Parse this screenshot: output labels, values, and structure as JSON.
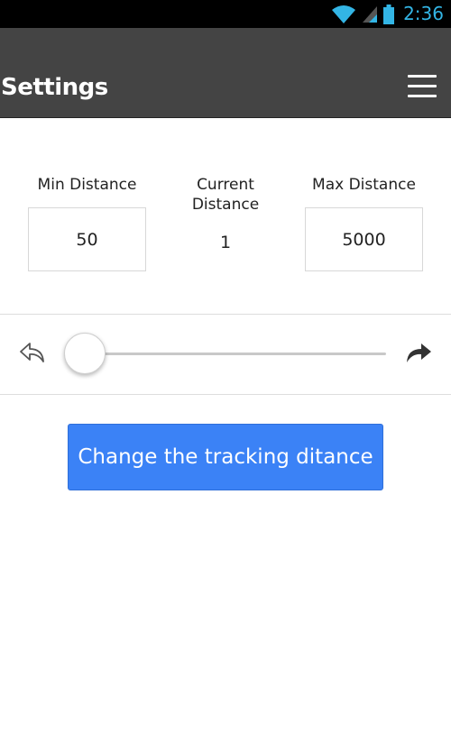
{
  "status_bar": {
    "time": "2:36",
    "icons": [
      "wifi-icon",
      "cell-signal-icon",
      "battery-icon"
    ]
  },
  "app_bar": {
    "title": "Settings",
    "menu_icon": "hamburger-menu-icon"
  },
  "distance": {
    "min_label": "Min Distance",
    "min_value": "50",
    "current_label": "Current Distance",
    "current_value": "1",
    "max_label": "Max Distance",
    "max_value": "5000"
  },
  "slider": {
    "value": 1,
    "min": 50,
    "max": 5000,
    "left_icon": "undo-arrow-icon",
    "right_icon": "redo-arrow-icon"
  },
  "action": {
    "button_label": "Change the tracking ditance"
  },
  "colors": {
    "status_bar_bg": "#000000",
    "status_accent": "#33b5e5",
    "app_bar_bg": "#444444",
    "primary_button": "#3b82f6"
  }
}
